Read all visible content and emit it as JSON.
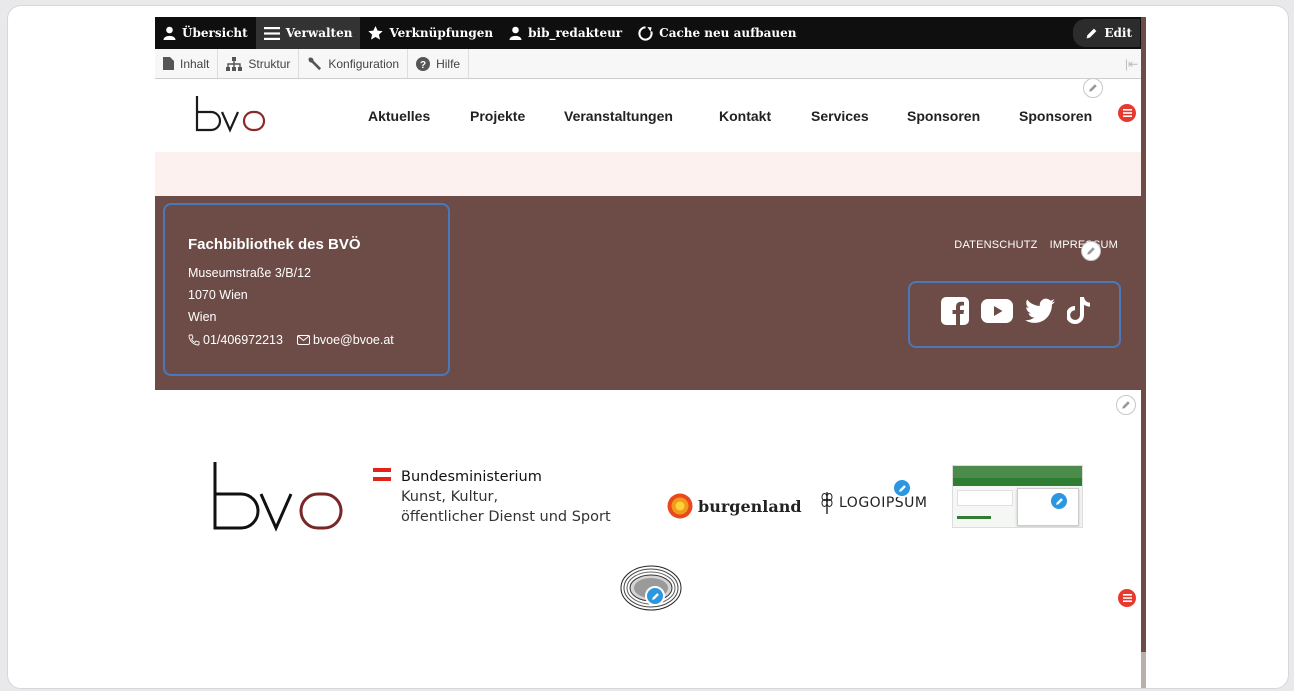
{
  "toolbar": {
    "items": [
      {
        "label": "Übersicht",
        "icon": "person-icon"
      },
      {
        "label": "Verwalten",
        "icon": "menu-icon"
      },
      {
        "label": "Verknüpfungen",
        "icon": "star-icon"
      },
      {
        "label": "bib_redakteur",
        "icon": "person-icon"
      },
      {
        "label": "Cache neu aufbauen",
        "icon": "refresh-icon"
      }
    ],
    "edit_label": "Edit"
  },
  "subbar": {
    "items": [
      {
        "label": "Inhalt",
        "icon": "page-icon"
      },
      {
        "label": "Struktur",
        "icon": "sitemap-icon"
      },
      {
        "label": "Konfiguration",
        "icon": "wrench-icon"
      },
      {
        "label": "Hilfe",
        "icon": "help-icon"
      }
    ],
    "collapse_glyph": "|⇤"
  },
  "header": {
    "logo_text": "bvo",
    "nav": [
      "Aktuelles",
      "Projekte",
      "Veranstaltungen",
      "Kontakt",
      "Services",
      "Sponsoren",
      "Sponsoren"
    ]
  },
  "footer": {
    "title": "Fachbibliothek des BVÖ",
    "address": [
      "Museumstraße 3/B/12",
      "1070 Wien",
      "Wien"
    ],
    "phone": "01/406972213",
    "email": "bvoe@bvoe.at",
    "legal": [
      "DATENSCHUTZ",
      "IMPRESSUM"
    ],
    "social": [
      "facebook-icon",
      "youtube-icon",
      "twitter-icon",
      "tiktok-icon"
    ]
  },
  "sponsors": {
    "bvo_logo": "bvo",
    "ministry": {
      "line1": "Bundesministerium",
      "line2": "Kunst, Kultur,",
      "line3": "öffentlicher Dienst und Sport"
    },
    "burgenland": "burgenland",
    "logoipsum": "LOGOIPSUM"
  },
  "colors": {
    "footer_bg": "#6d4c48",
    "pink_band": "#fdf1ef",
    "toolbar_bg": "#0f0f0f",
    "accent_blue": "#4a78b8",
    "edit_blue": "#2b97e0",
    "badge_red": "#e8392e"
  }
}
